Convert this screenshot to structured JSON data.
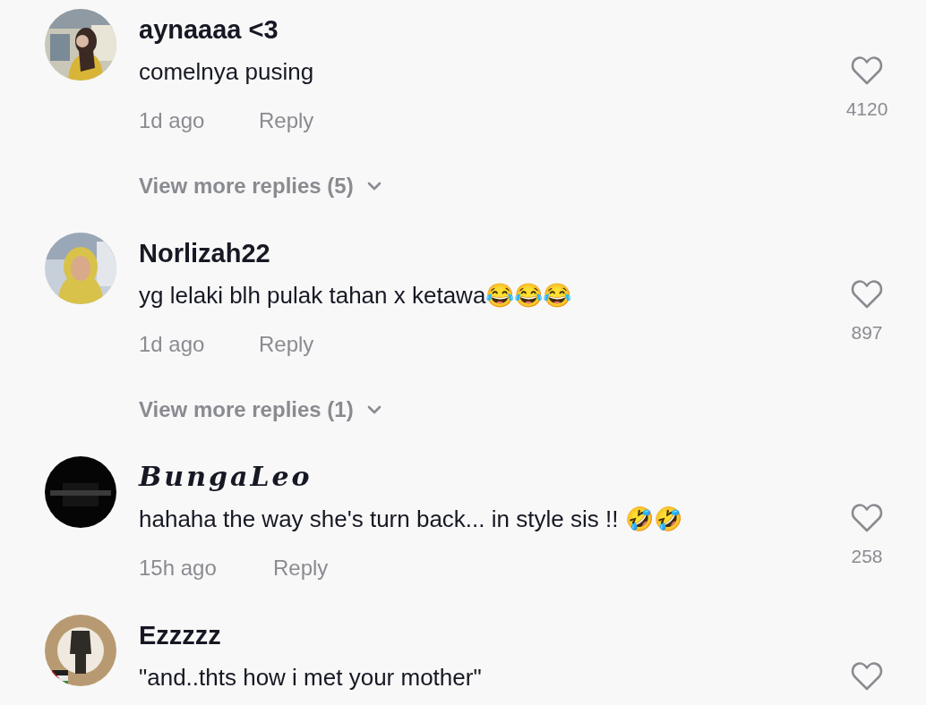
{
  "comments": [
    {
      "name": "aynaaaa <3",
      "kind": "plain",
      "text": "comelnya pusing",
      "time": "1d ago",
      "reply": "Reply",
      "likes": "4120",
      "liked": false,
      "more_replies": "View more replies (5)"
    },
    {
      "name": "Norlizah22",
      "kind": "plain",
      "text": "yg lelaki blh pulak tahan x ketawa😂😂😂",
      "time": "1d ago",
      "reply": "Reply",
      "likes": "897",
      "liked": false,
      "more_replies": "View more replies (1)"
    },
    {
      "name": "BungaLeo",
      "kind": "script",
      "text": "hahaha the way she's turn back... in style sis !! 🤣🤣",
      "time": "15h ago",
      "reply": "Reply",
      "likes": "258",
      "liked": false
    },
    {
      "name": "Ezzzzz",
      "kind": "plain",
      "text": "\"and..thts how i met your mother\"",
      "liked": false
    }
  ]
}
